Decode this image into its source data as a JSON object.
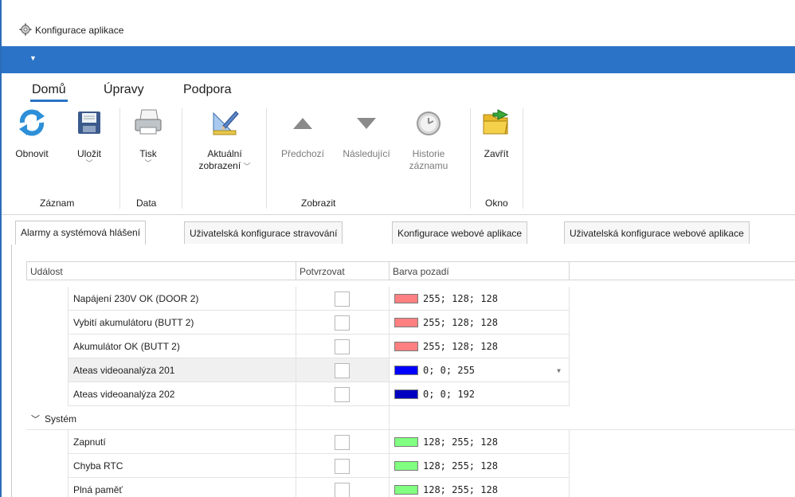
{
  "window": {
    "title": "Konfigurace aplikace",
    "icon": "gear-icon"
  },
  "ribbon_tabs": [
    {
      "label": "Domů",
      "active": true
    },
    {
      "label": "Úpravy",
      "active": false
    },
    {
      "label": "Podpora",
      "active": false
    }
  ],
  "ribbon": {
    "refresh": "Obnovit",
    "save": "Uložit",
    "print": "Tisk",
    "current_view_1": "Aktuální",
    "current_view_2": "zobrazení",
    "previous": "Předchozí",
    "next": "Následující",
    "history_1": "Historie",
    "history_2": "záznamu",
    "close": "Zavřít",
    "groups": {
      "record": "Záznam",
      "data": "Data",
      "view": "Zobrazit",
      "window": "Okno"
    }
  },
  "document_tabs": [
    "Alarmy a systémová hlášení",
    "Uživatelská konfigurace stravování",
    "Konfigurace webové aplikace",
    "Uživatelská konfigurace webové aplikace"
  ],
  "grid": {
    "columns": {
      "event": "Událost",
      "confirm": "Potvrzovat",
      "background": "Barva pozadí"
    },
    "rows": [
      {
        "event": "Napájení 230V OK (DOOR 2)",
        "color_label": "255; 128; 128",
        "color": "#ff8080"
      },
      {
        "event": "Vybití akumulátoru (BUTT 2)",
        "color_label": "255; 128; 128",
        "color": "#ff8080"
      },
      {
        "event": "Akumulátor OK (BUTT 2)",
        "color_label": "255; 128; 128",
        "color": "#ff8080"
      },
      {
        "event": "Ateas videoanalýza 201",
        "color_label": "0; 0; 255",
        "color": "#0000ff"
      },
      {
        "event": "Ateas videoanalýza 202",
        "color_label": "0; 0; 192",
        "color": "#0000c0"
      }
    ],
    "group": {
      "label": "Systém"
    },
    "group_rows": [
      {
        "event": "Zapnutí",
        "color_label": "128; 255; 128",
        "color": "#80ff80"
      },
      {
        "event": "Chyba RTC",
        "color_label": "128; 255; 128",
        "color": "#80ff80"
      },
      {
        "event": "Plná paměť",
        "color_label": "128; 255; 128",
        "color": "#80ff80"
      }
    ]
  },
  "colors": {
    "accent": "#2b73c7"
  }
}
